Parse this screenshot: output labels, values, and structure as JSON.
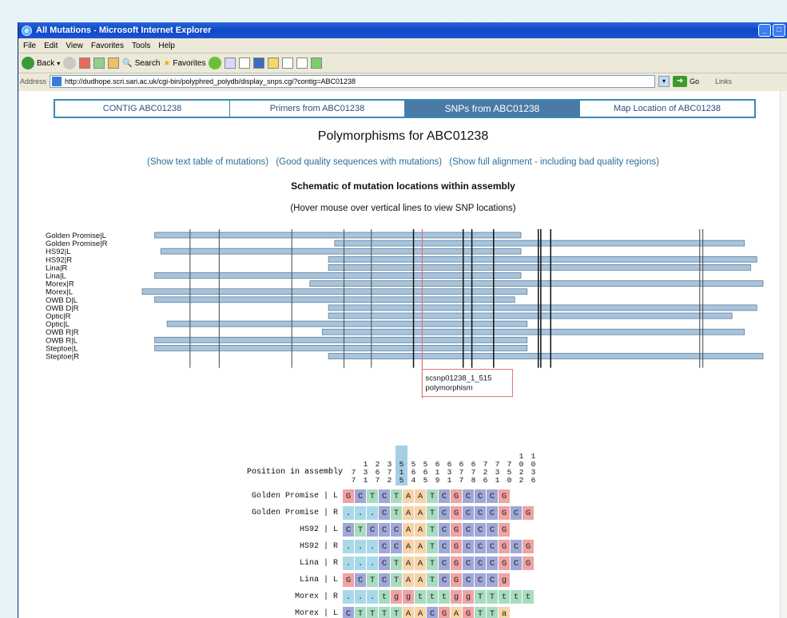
{
  "window": {
    "title": "All Mutations - Microsoft Internet Explorer"
  },
  "menu": [
    "File",
    "Edit",
    "View",
    "Favorites",
    "Tools",
    "Help"
  ],
  "toolbar": {
    "back": "Back",
    "search": "Search",
    "favorites": "Favorites"
  },
  "address": {
    "label": "Address",
    "url": "http://dudhope.scri.sari.ac.uk/cgi-bin/polyphred_polydb/display_snps.cgi?contig=ABC01238",
    "go": "Go",
    "links": "Links"
  },
  "tabs": [
    {
      "label": "CONTIG ABC01238",
      "active": false
    },
    {
      "label": "Primers from ABC01238",
      "active": false
    },
    {
      "label": "SNPs from ABC01238",
      "active": true
    },
    {
      "label": "Map Location of ABC01238",
      "active": false
    }
  ],
  "page": {
    "title": "Polymorphisms for ABC01238",
    "link_text_table": "(Show text table of mutations)",
    "link_good_quality": "(Good quality sequences with mutations)",
    "link_full_alignment": "(Show full alignment - including bad quality regions)",
    "schematic_title": "Schematic of mutation locations within assembly",
    "hover_note": "(Hover mouse over vertical lines to view SNP locations)"
  },
  "schematic": {
    "reads": [
      {
        "name": "Golden Promise|L",
        "start": 0.02,
        "end": 0.61
      },
      {
        "name": "Golden Promise|R",
        "start": 0.31,
        "end": 0.97
      },
      {
        "name": "HS92|L",
        "start": 0.03,
        "end": 0.61
      },
      {
        "name": "HS92|R",
        "start": 0.3,
        "end": 0.99
      },
      {
        "name": "Lina|R",
        "start": 0.3,
        "end": 0.98
      },
      {
        "name": "Lina|L",
        "start": 0.02,
        "end": 0.61
      },
      {
        "name": "Morex|R",
        "start": 0.27,
        "end": 1.0
      },
      {
        "name": "Morex|L",
        "start": 0.0,
        "end": 0.62
      },
      {
        "name": "OWB D|L",
        "start": 0.02,
        "end": 0.6
      },
      {
        "name": "OWB D|R",
        "start": 0.3,
        "end": 0.99
      },
      {
        "name": "Optic|R",
        "start": 0.3,
        "end": 0.95
      },
      {
        "name": "Optic|L",
        "start": 0.04,
        "end": 0.62
      },
      {
        "name": "OWB R|R",
        "start": 0.29,
        "end": 0.97
      },
      {
        "name": "OWB R|L",
        "start": 0.02,
        "end": 0.62
      },
      {
        "name": "Steptoe|L",
        "start": 0.02,
        "end": 0.62
      },
      {
        "name": "Steptoe|R",
        "start": 0.3,
        "end": 1.0
      }
    ],
    "snp_lines": [
      0.077,
      0.124,
      0.241,
      0.325,
      0.369,
      0.437,
      0.517,
      0.531,
      0.566,
      0.638,
      0.642,
      0.658,
      0.898,
      0.903
    ],
    "selected_snp": 0.451,
    "tooltip": {
      "line1": "scsnp01238_1_515",
      "line2": "polymorphism"
    }
  },
  "alignment": {
    "position_label": "Position in assembly",
    "highlight_col": 4,
    "positions": [
      [
        "",
        "",
        "7",
        "7"
      ],
      [
        "",
        "1",
        "3",
        "1"
      ],
      [
        "",
        "2",
        "6",
        "7"
      ],
      [
        "",
        "3",
        "7",
        "2"
      ],
      [
        "",
        "5",
        "1",
        "5"
      ],
      [
        "",
        "5",
        "6",
        "4"
      ],
      [
        "",
        "5",
        "6",
        "5"
      ],
      [
        "",
        "6",
        "1",
        "9"
      ],
      [
        "",
        "6",
        "3",
        "1"
      ],
      [
        "",
        "6",
        "7",
        "7"
      ],
      [
        "",
        "6",
        "7",
        "8"
      ],
      [
        "",
        "7",
        "2",
        "6"
      ],
      [
        "",
        "7",
        "3",
        "1"
      ],
      [
        "",
        "7",
        "5",
        "0"
      ],
      [
        "1",
        "0",
        "2",
        "2"
      ],
      [
        "1",
        "0",
        "3",
        "6"
      ]
    ],
    "rows": [
      {
        "name": "Golden Promise | L",
        "bases": [
          "G",
          "C",
          "T",
          "C",
          "T",
          "A",
          "A",
          "T",
          "C",
          "G",
          "C",
          "C",
          "C",
          "G",
          "",
          ""
        ]
      },
      {
        "name": "Golden Promise | R",
        "bases": [
          ".",
          ".",
          ".",
          "C",
          "T",
          "A",
          "A",
          "T",
          "C",
          "G",
          "C",
          "C",
          "C",
          "G",
          "C",
          "G"
        ]
      },
      {
        "name": "HS92 | L",
        "bases": [
          "C",
          "T",
          "C",
          "C",
          "C",
          "A",
          "A",
          "T",
          "C",
          "G",
          "C",
          "C",
          "C",
          "G",
          "",
          ""
        ]
      },
      {
        "name": "HS92 | R",
        "bases": [
          ".",
          ".",
          ".",
          "C",
          "C",
          "A",
          "A",
          "T",
          "C",
          "G",
          "C",
          "C",
          "C",
          "G",
          "C",
          "G"
        ]
      },
      {
        "name": "Lina | R",
        "bases": [
          ".",
          ".",
          ".",
          "C",
          "T",
          "A",
          "A",
          "T",
          "C",
          "G",
          "C",
          "C",
          "C",
          "G",
          "C",
          "G"
        ]
      },
      {
        "name": "Lina | L",
        "bases": [
          "G",
          "C",
          "T",
          "C",
          "T",
          "A",
          "A",
          "T",
          "C",
          "G",
          "C",
          "C",
          "C",
          "g",
          "",
          ""
        ]
      },
      {
        "name": "Morex | R",
        "bases": [
          ".",
          ".",
          ".",
          "t",
          "g",
          "g",
          "t",
          "t",
          "t",
          "g",
          "g",
          "T",
          "T",
          "t",
          "t",
          "t"
        ]
      },
      {
        "name": "Morex | L",
        "bases": [
          "C",
          "T",
          "T",
          "T",
          "T",
          "A",
          "A",
          "C",
          "G",
          "A",
          "G",
          "T",
          "T",
          "a",
          "",
          ""
        ]
      }
    ]
  }
}
